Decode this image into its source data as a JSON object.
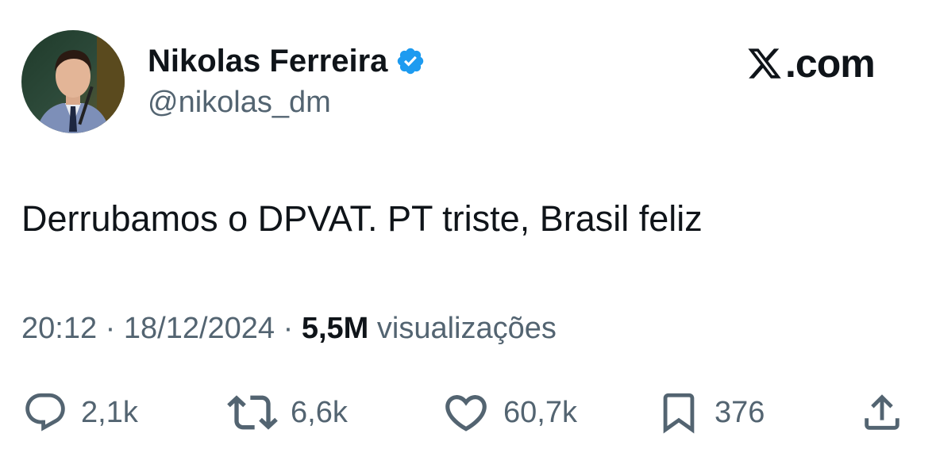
{
  "author": {
    "display_name": "Nikolas Ferreira",
    "handle": "@nikolas_dm",
    "verified": true,
    "verified_color": "#1d9bf0"
  },
  "brand": {
    "label": ".com",
    "icon": "x-logo-icon"
  },
  "tweet": {
    "text": "Derrubamos o DPVAT. PT triste, Brasil feliz"
  },
  "meta": {
    "time": "20:12",
    "separator": "·",
    "date": "18/12/2024",
    "views_count": "5,5M",
    "views_label": "visualizações"
  },
  "actions": {
    "reply": {
      "icon": "reply-icon",
      "count": "2,1k"
    },
    "retweet": {
      "icon": "retweet-icon",
      "count": "6,6k"
    },
    "like": {
      "icon": "heart-icon",
      "count": "60,7k"
    },
    "bookmark": {
      "icon": "bookmark-icon",
      "count": "376"
    },
    "share": {
      "icon": "share-icon"
    }
  },
  "colors": {
    "text_primary": "#0f1419",
    "text_secondary": "#536471",
    "icon_gray": "#536471"
  }
}
